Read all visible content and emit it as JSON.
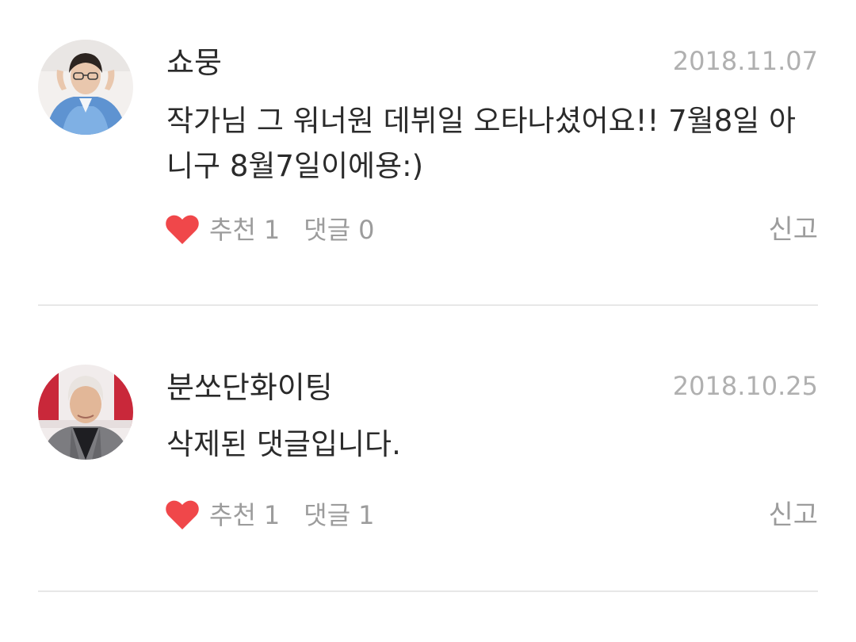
{
  "comments": [
    {
      "username": "쇼뭉",
      "date": "2018.11.07",
      "text": "작가님 그 워너원 데뷔일 오타나셨어요!! 7월8일 아니구 8월7일이에용:)",
      "like_label": "추천",
      "like_count": "1",
      "reply_label": "댓글",
      "reply_count": "0",
      "report_label": "신고"
    },
    {
      "username": "분쏘단화이팅",
      "date": "2018.10.25",
      "text": "삭제된 댓글입니다.",
      "like_label": "추천",
      "like_count": "1",
      "reply_label": "댓글",
      "reply_count": "1",
      "report_label": "신고"
    }
  ],
  "colors": {
    "heart": "#f0474a",
    "muted_text": "#9c9c9c",
    "date_text": "#b0b0b0",
    "divider": "#e7e7e7"
  },
  "icons": {
    "like": "heart-icon"
  }
}
